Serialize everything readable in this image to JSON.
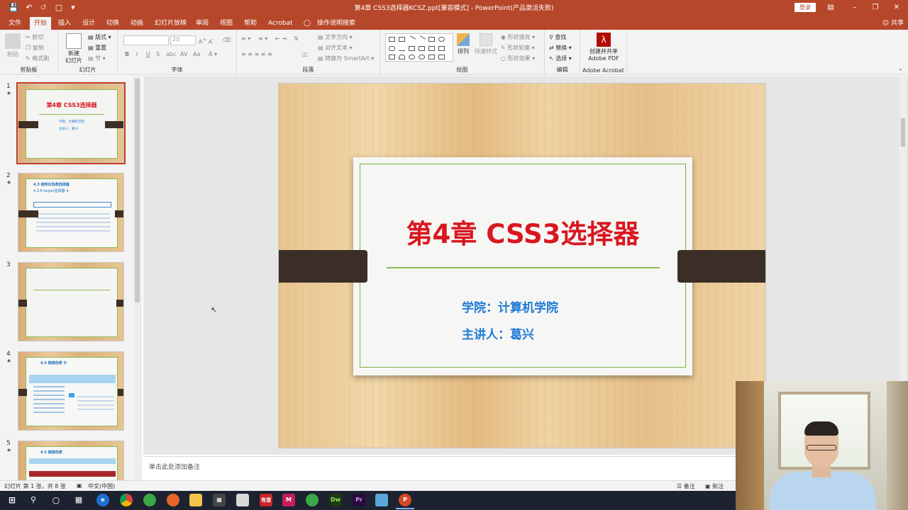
{
  "app": {
    "window_title": "第4章 CSS3选择器KCSZ.ppt[兼容模式] - PowerPoint(产品激活失败)",
    "login_label": "登录",
    "share_label": "共享",
    "tell_me": "操作说明搜索"
  },
  "tabs": [
    {
      "label": "文件"
    },
    {
      "label": "开始",
      "active": true
    },
    {
      "label": "插入"
    },
    {
      "label": "设计"
    },
    {
      "label": "切换"
    },
    {
      "label": "动画"
    },
    {
      "label": "幻灯片放映"
    },
    {
      "label": "审阅"
    },
    {
      "label": "视图"
    },
    {
      "label": "帮助"
    },
    {
      "label": "Acrobat"
    }
  ],
  "ribbon": {
    "clipboard": {
      "label": "剪贴板",
      "paste": "粘贴",
      "cut": "剪切",
      "copy": "复制",
      "format_painter": "格式刷"
    },
    "slides": {
      "label": "幻灯片",
      "new_slide": "新建\n幻灯片",
      "layout": "版式",
      "reset": "重置",
      "section": "节"
    },
    "font": {
      "label": "字体",
      "size": "20"
    },
    "paragraph": {
      "label": "段落",
      "text_direction": "文字方向",
      "align_text": "对齐文本",
      "smartart": "转换为 SmartArt"
    },
    "drawing": {
      "label": "绘图",
      "arrange": "排列",
      "quick_styles": "快速样式",
      "fill": "形状填充",
      "outline": "形状轮廓",
      "effects": "形状效果"
    },
    "editing": {
      "label": "编辑",
      "find": "查找",
      "replace": "替换",
      "select": "选择"
    },
    "acrobat": {
      "label": "Adobe Acrobat",
      "create_share": "创建并共享\nAdobe PDF"
    }
  },
  "thumbnails": [
    {
      "number": "1",
      "star": "★",
      "title": "第4章 CSS3选择器",
      "lines": [
        "学院：计算机学院",
        "主讲人：葛兴"
      ]
    },
    {
      "number": "2",
      "star": "★",
      "title": "4.3  结构化伪类选择器",
      "subtitle": "4.3.8  target选择器 ※"
    },
    {
      "number": "3",
      "star": ""
    },
    {
      "number": "4",
      "star": "★",
      "title": "4.5  链接伪类 ※"
    },
    {
      "number": "5",
      "star": "★",
      "title": "4.5  链接伪类"
    }
  ],
  "slide": {
    "title": "第4章 CSS3选择器",
    "college": "学院：计算机学院",
    "lecturer": "主讲人：葛兴"
  },
  "notes_placeholder": "单击此处添加备注",
  "statusbar": {
    "slide_info": "幻灯片 第 1 张，共 8 张",
    "language": "中文(中国)",
    "notes": "备注",
    "comments": "批注"
  },
  "taskbar": {
    "app_labels": [
      "有道",
      "Dw",
      "Pr"
    ]
  },
  "colors": {
    "accent": "#b7472a",
    "slide_title": "#d8171f",
    "slide_subtitle": "#1f7ad8",
    "frame_green": "#7fb143"
  }
}
